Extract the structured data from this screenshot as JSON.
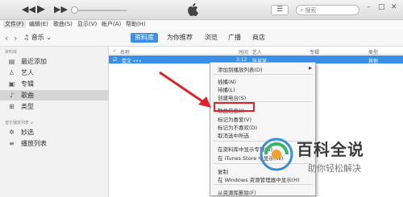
{
  "toolbar": {
    "rewind_icon": "rewind-icon",
    "play_icon": "play-icon",
    "fast_forward_icon": "fast-forward-icon",
    "volume_level": 0.05,
    "list_icon": "list-icon",
    "search_placeholder": "搜索",
    "window_buttons": [
      "–",
      "□",
      "✕"
    ]
  },
  "menubar": {
    "items": [
      "文件(F)",
      "编辑(E)",
      "歌曲(S)",
      "显示(V)",
      "帐户(A)",
      "帮助(H)"
    ]
  },
  "navbar": {
    "music_selector": "音乐",
    "tabs": [
      "资料库",
      "为你推荐",
      "浏览",
      "广播",
      "商店"
    ],
    "active_tab": "资料库"
  },
  "sidebar": {
    "library_header": "资料库",
    "items": [
      {
        "label": "最近添加",
        "icon": "recent-icon"
      },
      {
        "label": "艺人",
        "icon": "artist-icon"
      },
      {
        "label": "专辑",
        "icon": "album-icon"
      },
      {
        "label": "歌曲",
        "icon": "song-icon"
      },
      {
        "label": "类型",
        "icon": "genre-icon"
      }
    ],
    "active_item": "歌曲",
    "playlist_header": "音乐播放列表 ∨",
    "playlists": [
      {
        "label": "妙选",
        "icon": "genius-icon"
      },
      {
        "label": "播放列表",
        "icon": "playlist-icon"
      }
    ]
  },
  "table": {
    "headers": [
      "名称",
      "时间",
      "艺人",
      "专辑",
      "类型"
    ],
    "rows": [
      {
        "name": "壹文 •••",
        "time": "3:12",
        "artist": "张某某",
        "album": "",
        "genre": "其他"
      }
    ]
  },
  "context_menu": {
    "items": [
      "添加到播放列表(D)",
      "插播(N)",
      "待播(L)",
      "创建电台(S)",
      "歌曲信息(I)",
      "标记为喜爱(V)",
      "标记为不喜欢(D)",
      "取消选中所选",
      "在资料库中显示专辑(B)",
      "在 iTunes Store 中显示(W)",
      "复制",
      "在 Windows 资源管理器中显示(H)",
      "从资源库删除(F)"
    ],
    "highlighted_item": "歌曲信息(I)",
    "submenu_arrow": "▶"
  },
  "watermark": {
    "title": "百科全说",
    "subtitle": "助你轻松解决"
  },
  "colors": {
    "accent": "#3b8fe5",
    "highlight": "#e0232b"
  }
}
